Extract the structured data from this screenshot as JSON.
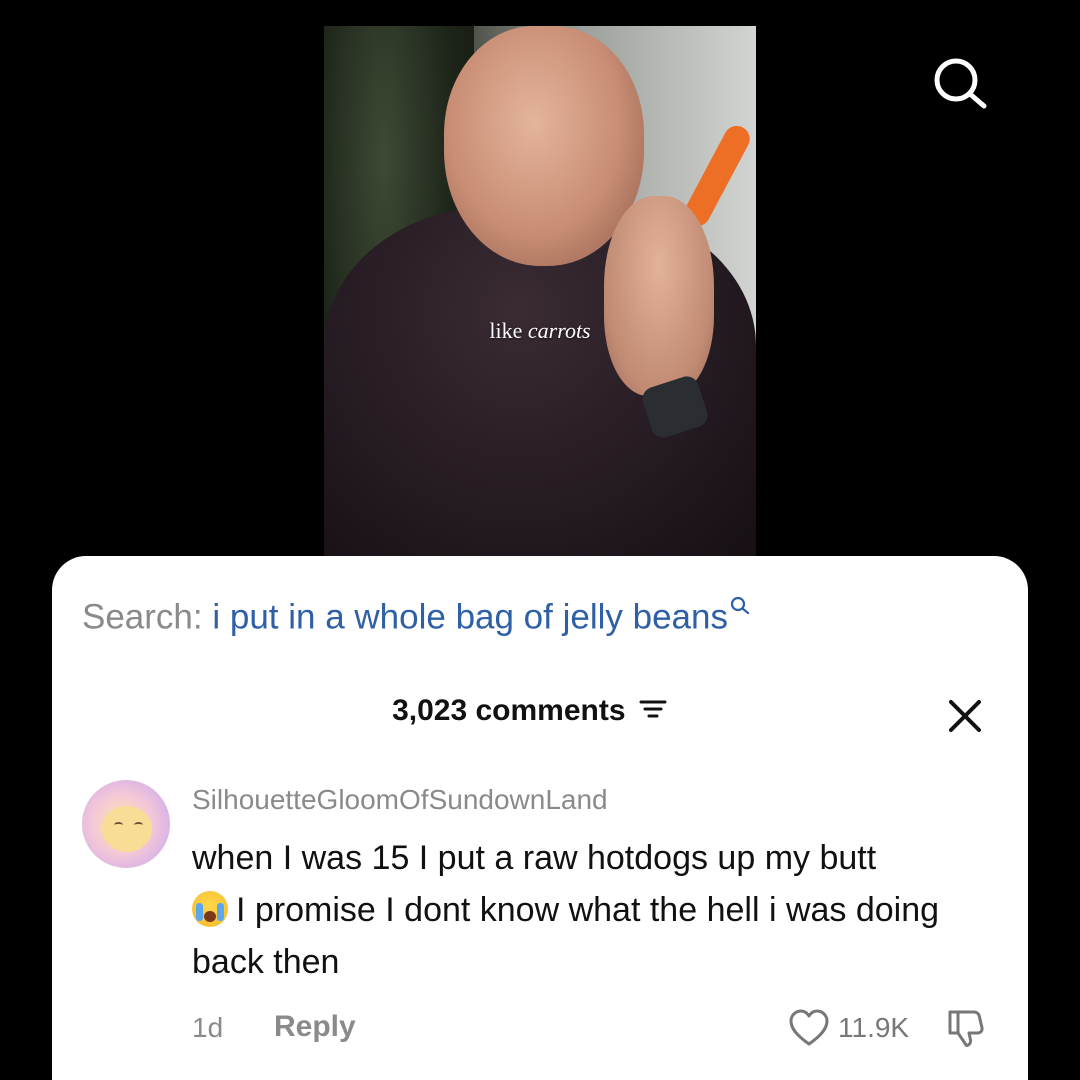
{
  "video": {
    "caption_plain": "like",
    "caption_italic": "carrots"
  },
  "top_bar": {
    "search_icon": "search-icon"
  },
  "panel": {
    "search_prefix": "Search:",
    "search_query": "i put in a whole bag of jelly beans",
    "comments_count": "3,023 comments",
    "filter_icon": "filter-icon",
    "close_icon": "close-icon"
  },
  "comment": {
    "username": "SilhouetteGloomOfSundownLand",
    "text_line1": "when I was 15 I put a raw hotdogs up my butt",
    "emoji": "loudly-crying-face-emoji",
    "text_rest": "I promise I dont know what the hell i was doing back then",
    "time": "1d",
    "reply_label": "Reply",
    "likes": "11.9K",
    "like_icon": "heart-icon",
    "dislike_icon": "thumbs-down-icon"
  },
  "colors": {
    "link_blue": "#2f5fa5",
    "muted_gray": "#8a8a8a",
    "background": "#000000",
    "panel": "#ffffff"
  }
}
